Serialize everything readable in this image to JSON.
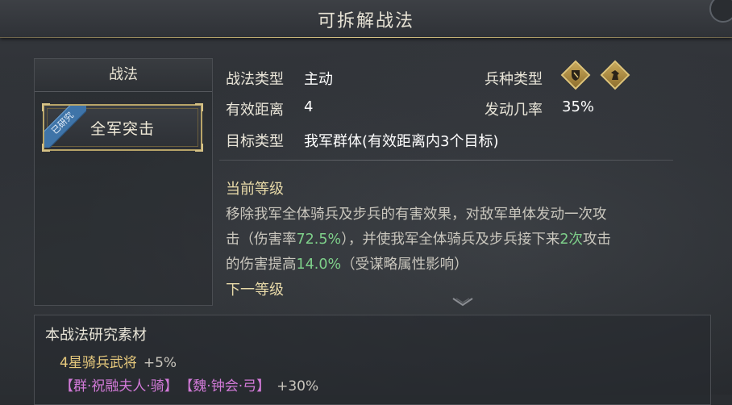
{
  "title": "可拆解战法",
  "left_panel": {
    "header": "战法",
    "skill": {
      "name": "全军突击",
      "badge": "已研究"
    }
  },
  "info": {
    "type_label": "战法类型",
    "type_value": "主动",
    "range_label": "有效距离",
    "range_value": "4",
    "target_label": "目标类型",
    "target_value": "我军群体(有效距离内3个目标)",
    "troop_label": "兵种类型",
    "troop_icons": [
      "shield-cavalry-icon",
      "horse-head-icon"
    ],
    "rate_label": "发动几率",
    "rate_value": "35%"
  },
  "current_level": {
    "title": "当前等级",
    "line1": "移除我军全体骑兵及步兵的有害效果，对敌军单体发动一次攻",
    "line2_a": "击（伤害率",
    "line2_b": "72.5%",
    "line2_c": "），并使我军全体骑兵及步兵接下来",
    "line2_d": "2次",
    "line2_e": "攻击",
    "line3_a": "的伤害提高",
    "line3_b": "14.0%",
    "line3_c": "（受谋略属性影响）"
  },
  "next_level": {
    "title": "下一等级"
  },
  "materials": {
    "title": "本战法研究素材",
    "row1_label": "4星骑兵武将",
    "row1_bonus": "+5%",
    "row2_item1": "【群·祝融夫人·骑】",
    "row2_item2": "【魏·钟会·弓】",
    "row2_bonus": "+30%"
  },
  "colors": {
    "accent_gold": "#b8a468",
    "highlight_green": "#7ed08a",
    "general_purple": "#d27ad8",
    "badge_blue": "#3f74a8"
  }
}
